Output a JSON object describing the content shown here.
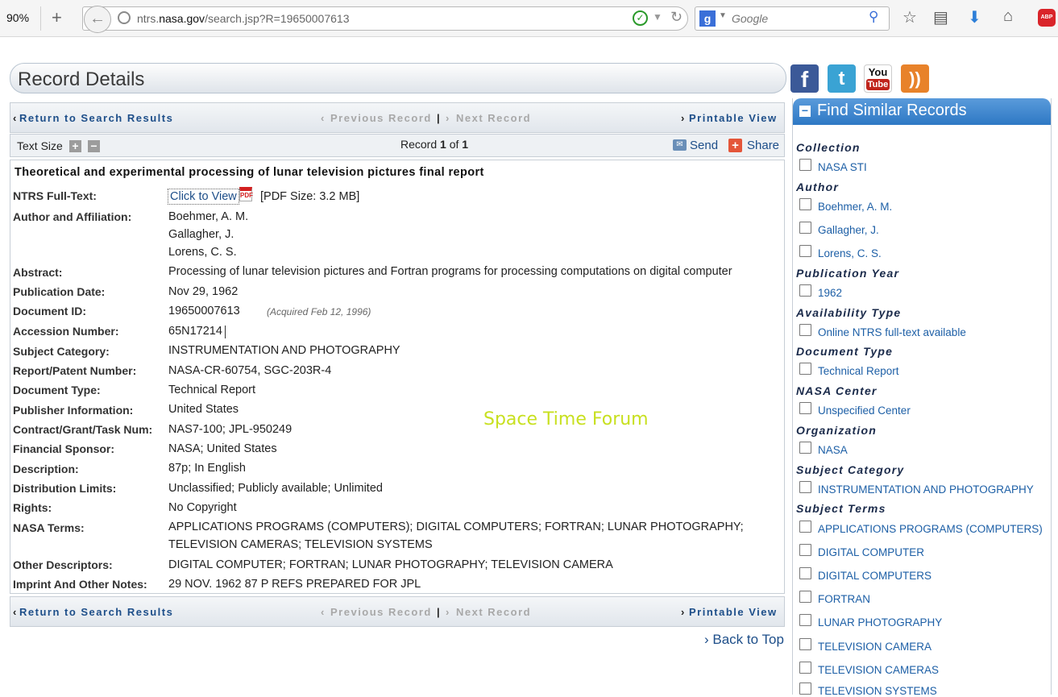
{
  "browser": {
    "zoom": "90%",
    "url_prefix": "ntrs.",
    "url_domain": "nasa.gov",
    "url_path": "/search.jsp?R=19650007613",
    "search_placeholder": "Google",
    "abp_label": "ABP"
  },
  "header": {
    "title": "Record Details"
  },
  "social": {
    "facebook": "f",
    "twitter": "t",
    "youtube_top": "You",
    "youtube_bottom": "Tube"
  },
  "nav": {
    "return_label": "Return to Search Results",
    "previous_label": "Previous Record",
    "next_label": "Next Record",
    "printable_label": "Printable View",
    "separator": "|",
    "chevron": "‹",
    "chevron_right": "›"
  },
  "toolbar": {
    "text_size_label": "Text Size",
    "record_prefix": "Record ",
    "record_index": "1",
    "record_of": " of ",
    "record_total": "1",
    "send_label": "Send",
    "share_label": "Share"
  },
  "record": {
    "title": "Theoretical and experimental processing of lunar television pictures final report",
    "full_text_label": "NTRS Full-Text:",
    "click_to_view": "Click to View",
    "pdf_size": "[PDF Size: 3.2 MB]",
    "author_label": "Author and Affiliation:",
    "authors": [
      "Boehmer, A. M.",
      "Gallagher, J.",
      "Lorens, C. S."
    ],
    "abstract_label": "Abstract:",
    "abstract": "Processing of lunar television pictures and Fortran programs for processing computations on digital computer",
    "pubdate_label": "Publication Date:",
    "pubdate": "Nov 29, 1962",
    "docid_label": "Document ID:",
    "docid": "19650007613",
    "acquired": "(Acquired Feb 12, 1996)",
    "accession_label": "Accession Number:",
    "accession": "65N17214",
    "subject_label": "Subject Category:",
    "subject": "INSTRUMENTATION AND PHOTOGRAPHY",
    "report_label": "Report/Patent Number:",
    "report": "NASA-CR-60754, SGC-203R-4",
    "doctype_label": "Document Type:",
    "doctype": "Technical Report",
    "publisher_label": "Publisher Information:",
    "publisher": "United States",
    "contract_label": "Contract/Grant/Task Num:",
    "contract": "NAS7-100; JPL-950249",
    "sponsor_label": "Financial Sponsor:",
    "sponsor": "NASA; United States",
    "description_label": "Description:",
    "description": "87p; In English",
    "distribution_label": "Distribution Limits:",
    "distribution": "Unclassified; Publicly available; Unlimited",
    "rights_label": "Rights:",
    "rights": "No Copyright",
    "terms_label": "NASA Terms:",
    "terms_line1": "APPLICATIONS PROGRAMS (COMPUTERS); DIGITAL COMPUTERS; FORTRAN; LUNAR PHOTOGRAPHY;",
    "terms_line2": "TELEVISION CAMERAS; TELEVISION SYSTEMS",
    "descriptors_label": "Other Descriptors:",
    "descriptors": "DIGITAL COMPUTER; FORTRAN; LUNAR PHOTOGRAPHY; TELEVISION CAMERA",
    "imprint_label": "Imprint And Other Notes:",
    "imprint": "29 NOV. 1962 87 P REFS PREPARED FOR JPL"
  },
  "watermark": "Space Time Forum",
  "back_to_top": "› Back to Top",
  "sidebar": {
    "title": "Find Similar Records",
    "collection_heading": "Collection",
    "collection": [
      "NASA STI"
    ],
    "author_heading": "Author",
    "authors": [
      "Boehmer, A. M.",
      "Gallagher, J.",
      "Lorens, C. S."
    ],
    "year_heading": "Publication Year",
    "years": [
      "1962"
    ],
    "availability_heading": "Availability Type",
    "availability": [
      "Online NTRS full-text available"
    ],
    "doctype_heading": "Document Type",
    "doctypes": [
      "Technical Report"
    ],
    "center_heading": "NASA Center",
    "centers": [
      "Unspecified Center"
    ],
    "org_heading": "Organization",
    "orgs": [
      "NASA"
    ],
    "subject_heading": "Subject Category",
    "subjects": [
      "INSTRUMENTATION AND PHOTOGRAPHY"
    ],
    "terms_heading": "Subject Terms",
    "terms": [
      "APPLICATIONS PROGRAMS (COMPUTERS)",
      "DIGITAL COMPUTER",
      "DIGITAL COMPUTERS",
      "FORTRAN",
      "LUNAR PHOTOGRAPHY",
      "TELEVISION CAMERA",
      "TELEVISION CAMERAS",
      "TELEVISION SYSTEMS"
    ]
  }
}
